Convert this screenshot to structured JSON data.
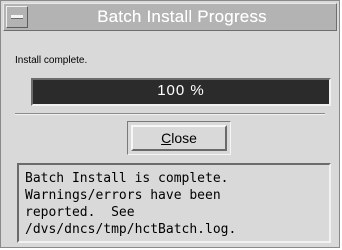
{
  "window": {
    "title": "Batch Install Progress"
  },
  "status": {
    "text": "Install complete."
  },
  "progress": {
    "percent_label": "100 %",
    "value": 100
  },
  "buttons": {
    "close_label_mnemonic": "C",
    "close_label_rest": "lose"
  },
  "message": {
    "lines": [
      "Batch Install is complete.",
      "Warnings/errors have been",
      "reported.  See",
      "/dvs/dncs/tmp/hctBatch.log."
    ]
  },
  "colors": {
    "titlebar": "#b3b3b3",
    "window_bg": "#d9d9d9",
    "progress_fill": "#2b2b2b"
  },
  "icons": {
    "window_menu": "window-menu-icon"
  }
}
